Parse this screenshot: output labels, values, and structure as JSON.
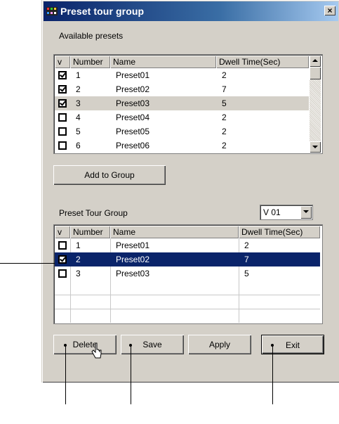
{
  "window": {
    "title": "Preset tour group",
    "close_glyph": "×"
  },
  "available": {
    "label": "Available presets",
    "columns": [
      "v",
      "Number",
      "Name",
      "Dwell Time(Sec)"
    ],
    "rows": [
      {
        "checked": true,
        "number": "1",
        "name": "Preset01",
        "dwell": "2"
      },
      {
        "checked": true,
        "number": "2",
        "name": "Preset02",
        "dwell": "7"
      },
      {
        "checked": true,
        "number": "3",
        "name": "Preset03",
        "dwell": "5"
      },
      {
        "checked": false,
        "number": "4",
        "name": "Preset04",
        "dwell": "2"
      },
      {
        "checked": false,
        "number": "5",
        "name": "Preset05",
        "dwell": "2"
      },
      {
        "checked": false,
        "number": "6",
        "name": "Preset06",
        "dwell": "2"
      }
    ]
  },
  "add_button": "Add to Group",
  "group": {
    "label": "Preset Tour Group",
    "combo_value": "V 01",
    "columns": [
      "v",
      "Number",
      "Name",
      "Dwell Time(Sec)"
    ],
    "rows": [
      {
        "checked": false,
        "number": "1",
        "name": "Preset01",
        "dwell": "2"
      },
      {
        "checked": true,
        "number": "2",
        "name": "Preset02",
        "dwell": "7"
      },
      {
        "checked": false,
        "number": "3",
        "name": "Preset03",
        "dwell": "5"
      }
    ]
  },
  "buttons": {
    "delete": "Delete",
    "save": "Save",
    "apply": "Apply",
    "exit": "Exit"
  },
  "colors": {
    "selection": "#0a246a",
    "face": "#d4d0c8"
  }
}
